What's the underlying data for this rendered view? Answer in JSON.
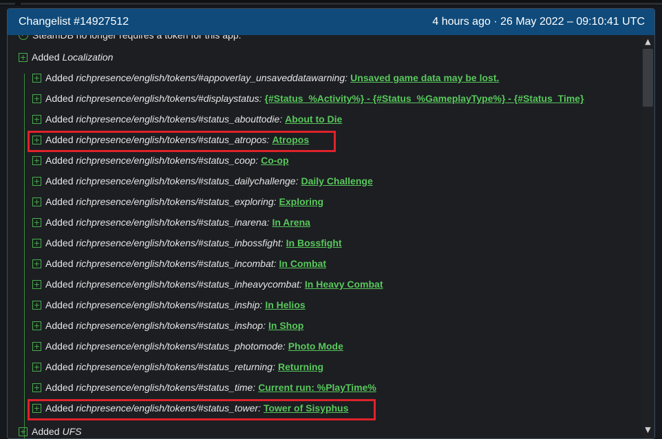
{
  "header": {
    "title": "Changelist #14927512",
    "timestamp": "4 hours ago · 26 May 2022 – 09:10:41 UTC"
  },
  "notice": "SteamDB no longer requires a token for this app.",
  "section": {
    "action": "Added",
    "name": "Localization"
  },
  "items": [
    {
      "action": "Added",
      "path": "richpresence/english/tokens/#appoverlay_unsaveddatawarning:",
      "value": "Unsaved game data may be lost."
    },
    {
      "action": "Added",
      "path": "richpresence/english/tokens/#displaystatus:",
      "value": "{#Status_%Activity%} - {#Status_%GameplayType%} - {#Status_Time}"
    },
    {
      "action": "Added",
      "path": "richpresence/english/tokens/#status_abouttodie:",
      "value": "About to Die"
    },
    {
      "action": "Added",
      "path": "richpresence/english/tokens/#status_atropos:",
      "value": "Atropos"
    },
    {
      "action": "Added",
      "path": "richpresence/english/tokens/#status_coop:",
      "value": "Co-op"
    },
    {
      "action": "Added",
      "path": "richpresence/english/tokens/#status_dailychallenge:",
      "value": "Daily Challenge"
    },
    {
      "action": "Added",
      "path": "richpresence/english/tokens/#status_exploring:",
      "value": "Exploring"
    },
    {
      "action": "Added",
      "path": "richpresence/english/tokens/#status_inarena:",
      "value": "In Arena"
    },
    {
      "action": "Added",
      "path": "richpresence/english/tokens/#status_inbossfight:",
      "value": "In Bossfight"
    },
    {
      "action": "Added",
      "path": "richpresence/english/tokens/#status_incombat:",
      "value": "In Combat"
    },
    {
      "action": "Added",
      "path": "richpresence/english/tokens/#status_inheavycombat:",
      "value": "In Heavy Combat"
    },
    {
      "action": "Added",
      "path": "richpresence/english/tokens/#status_inship:",
      "value": "In Helios"
    },
    {
      "action": "Added",
      "path": "richpresence/english/tokens/#status_inshop:",
      "value": "In Shop"
    },
    {
      "action": "Added",
      "path": "richpresence/english/tokens/#status_photomode:",
      "value": "Photo Mode"
    },
    {
      "action": "Added",
      "path": "richpresence/english/tokens/#status_returning:",
      "value": "Returning"
    },
    {
      "action": "Added",
      "path": "richpresence/english/tokens/#status_time:",
      "value": "Current run: %PlayTime%"
    },
    {
      "action": "Added",
      "path": "richpresence/english/tokens/#status_tower:",
      "value": "Tower of Sisyphus"
    }
  ],
  "next_section": {
    "action": "Added",
    "name": "UFS"
  },
  "colors": {
    "header_bg": "#0f4a7a",
    "added_green": "#59c85c",
    "highlight_red": "#e0222a"
  }
}
